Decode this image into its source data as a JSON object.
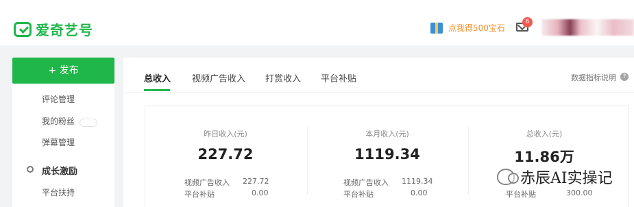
{
  "header": {
    "logo_text": "爱奇艺号",
    "promo_text": "点我得500宝石",
    "notification_count": "6"
  },
  "sidebar": {
    "publish_label": "+ 发布",
    "items": [
      "评论管理",
      "我的粉丝",
      "弹幕管理"
    ],
    "growth_title": "成长激励",
    "growth_items": [
      "平台扶持"
    ]
  },
  "main": {
    "tabs": [
      "总收入",
      "视频广告收入",
      "打赏收入",
      "平台补贴"
    ],
    "help_text": "数据指标说明",
    "help_symbol": "?"
  },
  "stats": [
    {
      "label": "昨日收入(元)",
      "value": "227.72",
      "details": [
        {
          "label": "视频广告收入",
          "value": "227.72"
        },
        {
          "label": "平台补贴",
          "value": "0.00"
        }
      ]
    },
    {
      "label": "本月收入(元)",
      "value": "1119.34",
      "details": [
        {
          "label": "视频广告收入",
          "value": "1119.34"
        },
        {
          "label": "平台补贴",
          "value": "0.00"
        }
      ]
    },
    {
      "label": "总收入(元)",
      "value": "11.86万",
      "details": [
        {
          "label": "平台补贴",
          "value": "300.00"
        }
      ]
    }
  ],
  "watermark": {
    "text": "赤辰AI实操记"
  },
  "colors": {
    "brand_green": "#20b74a",
    "promo_orange": "#f0912d",
    "badge_red": "#f05a4f"
  }
}
